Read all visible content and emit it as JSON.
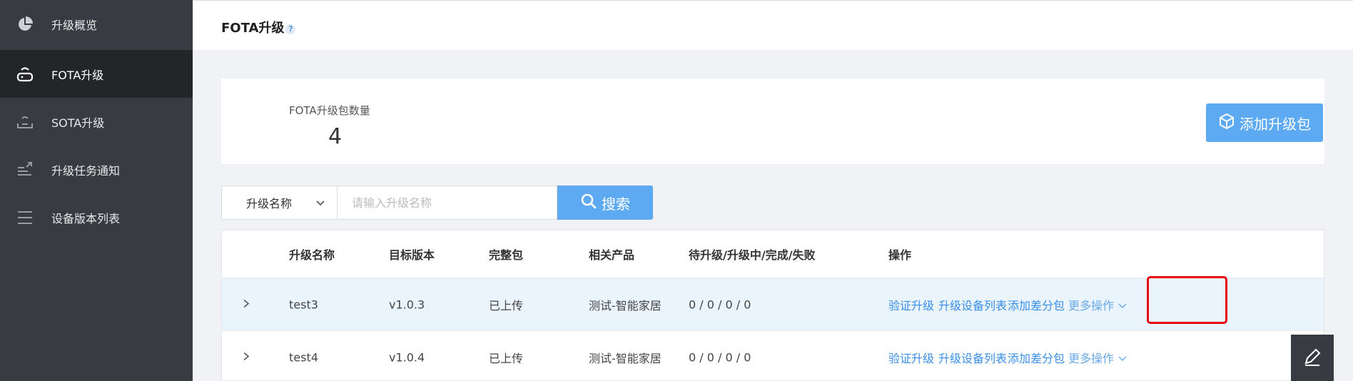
{
  "sidebar": {
    "items": [
      {
        "label": "升级概览",
        "icon": "pie-chart-icon"
      },
      {
        "label": "FOTA升级",
        "icon": "router-icon"
      },
      {
        "label": "SOTA升级",
        "icon": "tray-icon"
      },
      {
        "label": "升级任务通知",
        "icon": "notice-icon"
      },
      {
        "label": "设备版本列表",
        "icon": "list-icon"
      }
    ]
  },
  "header": {
    "title": "FOTA升级",
    "help": "?"
  },
  "summary": {
    "label": "FOTA升级包数量",
    "value": "4",
    "add_button": "添加升级包"
  },
  "search": {
    "select_value": "升级名称",
    "placeholder": "请输入升级名称",
    "button": "搜索"
  },
  "table": {
    "columns": [
      "升级名称",
      "目标版本",
      "完整包",
      "相关产品",
      "待升级/升级中/完成/失败",
      "操作"
    ],
    "rows": [
      {
        "name": "test3",
        "version": "v1.0.3",
        "package": "已上传",
        "product": "测试-智能家居",
        "status": "0 / 0 / 0 / 0",
        "actions": [
          "验证升级",
          "升级设备列表",
          "添加差分包",
          "更多操作"
        ]
      },
      {
        "name": "test4",
        "version": "v1.0.4",
        "package": "已上传",
        "product": "测试-智能家居",
        "status": "0 / 0 / 0 / 0",
        "actions": [
          "验证升级",
          "升级设备列表",
          "添加差分包",
          "更多操作"
        ]
      }
    ]
  },
  "colors": {
    "sidebar_bg": "#393b42",
    "sidebar_active": "#242529",
    "primary": "#5da9f2",
    "link": "#3a8ee6",
    "highlight": "#e60012"
  }
}
